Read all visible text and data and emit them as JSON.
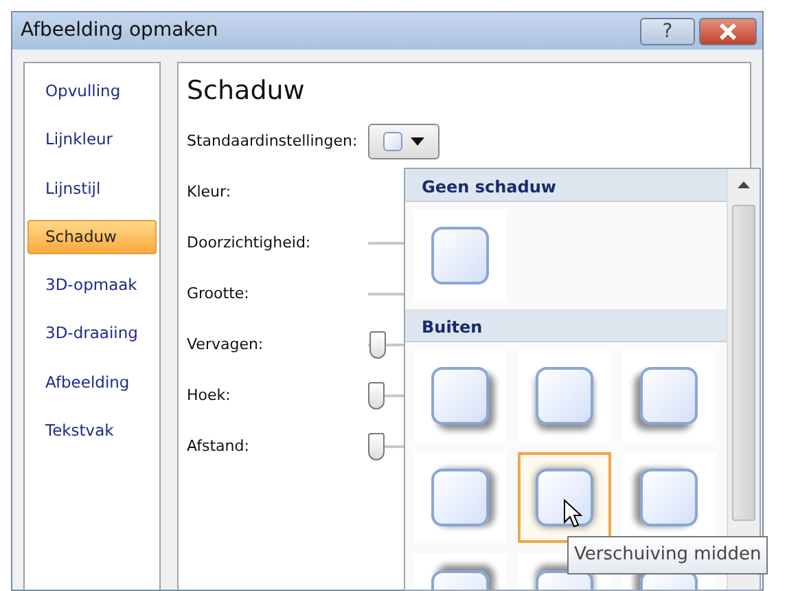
{
  "window": {
    "title": "Afbeelding opmaken",
    "help_button": "?"
  },
  "sidebar": {
    "items": [
      {
        "label": "Opvulling",
        "selected": false
      },
      {
        "label": "Lijnkleur",
        "selected": false
      },
      {
        "label": "Lijnstijl",
        "selected": false
      },
      {
        "label": "Schaduw",
        "selected": true
      },
      {
        "label": "3D-opmaak",
        "selected": false
      },
      {
        "label": "3D-draaiing",
        "selected": false
      },
      {
        "label": "Afbeelding",
        "selected": false
      },
      {
        "label": "Tekstvak",
        "selected": false
      }
    ]
  },
  "panel": {
    "heading": "Schaduw",
    "fields": [
      {
        "kind": "preset",
        "label": "Standaardinstellingen:"
      },
      {
        "kind": "plain",
        "label": "Kleur:"
      },
      {
        "kind": "track",
        "label": "Doorzichtigheid:"
      },
      {
        "kind": "track",
        "label": "Grootte:"
      },
      {
        "kind": "slider",
        "label": "Vervagen:",
        "level": 0.05
      },
      {
        "kind": "slider",
        "label": "Hoek:",
        "level": 0.0
      },
      {
        "kind": "slider",
        "label": "Afstand:",
        "level": 0.0
      }
    ]
  },
  "gallery": {
    "sections": [
      {
        "header": "Geen schaduw",
        "items": [
          {
            "selected": false
          }
        ]
      },
      {
        "header": "Buiten",
        "items": [
          {
            "selected": false
          },
          {
            "selected": false
          },
          {
            "selected": false
          },
          {
            "selected": false
          },
          {
            "selected": true
          },
          {
            "selected": false
          },
          {
            "selected": false
          },
          {
            "selected": false
          },
          {
            "selected": false
          }
        ]
      }
    ]
  },
  "tooltip": {
    "text": "Verschuiving midden"
  }
}
